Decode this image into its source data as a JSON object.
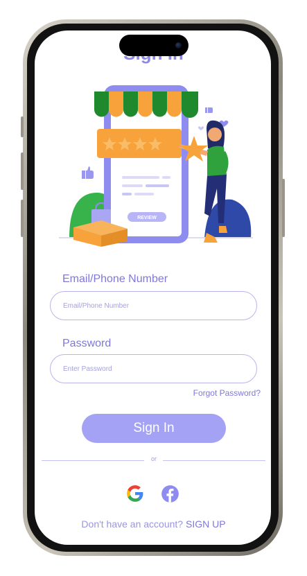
{
  "header": {
    "title": "Sign In"
  },
  "illustration": {
    "review_label": "REVIEW"
  },
  "form": {
    "email_label": "Email/Phone Number",
    "email_placeholder": "Email/Phone Number",
    "password_label": "Password",
    "password_placeholder": "Enter Password",
    "forgot_label": "Forgot Password?",
    "submit_label": "Sign In"
  },
  "divider": {
    "text": "or"
  },
  "social": [
    {
      "name": "google-icon"
    },
    {
      "name": "facebook-icon"
    }
  ],
  "footer": {
    "prompt": "Don't have an account?",
    "signup_label": "SIGN UP"
  },
  "colors": {
    "accent": "#7f78d9",
    "button": "#a4a2f4",
    "awning_green": "#1e8a2d",
    "awning_orange": "#f7a23a",
    "phone_purple": "#8f8cf0"
  }
}
